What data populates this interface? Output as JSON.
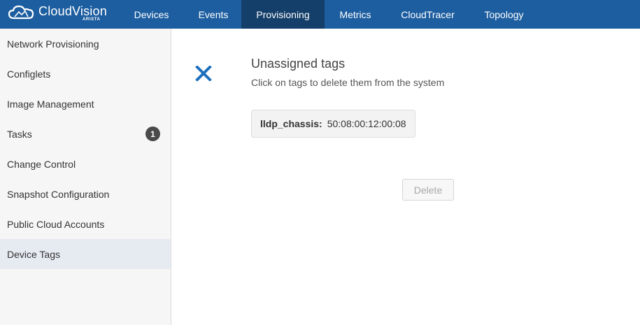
{
  "brand": {
    "name": "CloudVision",
    "sub": "ARISTA"
  },
  "nav": {
    "tabs": [
      {
        "label": "Devices",
        "active": false
      },
      {
        "label": "Events",
        "active": false
      },
      {
        "label": "Provisioning",
        "active": true
      },
      {
        "label": "Metrics",
        "active": false
      },
      {
        "label": "CloudTracer",
        "active": false
      },
      {
        "label": "Topology",
        "active": false
      }
    ]
  },
  "sidebar": {
    "items": [
      {
        "label": "Network Provisioning"
      },
      {
        "label": "Configlets"
      },
      {
        "label": "Image Management"
      },
      {
        "label": "Tasks",
        "badge": "1"
      },
      {
        "label": "Change Control"
      },
      {
        "label": "Snapshot Configuration"
      },
      {
        "label": "Public Cloud Accounts"
      },
      {
        "label": "Device Tags",
        "active": true
      }
    ]
  },
  "main": {
    "title": "Unassigned tags",
    "subtitle": "Click on tags to delete them from the system",
    "tag": {
      "key": "lldp_chassis:",
      "value": "50:08:00:12:00:08"
    },
    "delete_label": "Delete",
    "delete_disabled": true,
    "close_icon": "close-icon"
  },
  "colors": {
    "topbar": "#1d5ea0",
    "topbar_active": "#143f6a",
    "accent_icon": "#1d6fbd",
    "badge": "#4a4a4a"
  }
}
